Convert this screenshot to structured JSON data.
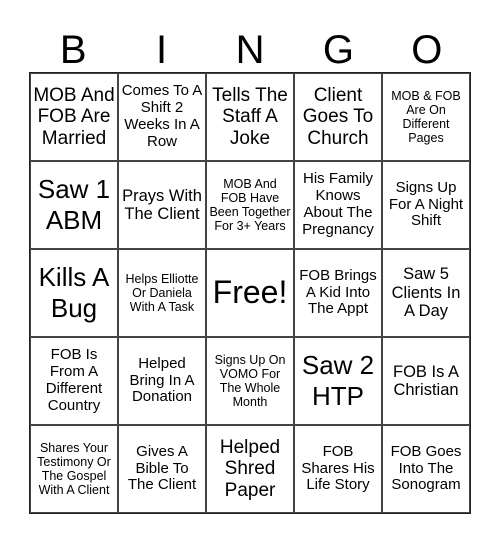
{
  "header": [
    "B",
    "I",
    "N",
    "G",
    "O"
  ],
  "cells": [
    "MOB And FOB Are Married",
    "Comes To A Shift 2 Weeks In A Row",
    "Tells The Staff A Joke",
    "Client Goes To Church",
    "MOB & FOB Are On Different Pages",
    "Saw 1 ABM",
    "Prays With The Client",
    "MOB And FOB Have Been Together For 3+ Years",
    "His Family Knows About The Pregnancy",
    "Signs Up For A Night Shift",
    "Kills A Bug",
    "Helps Elliotte Or Daniela With A Task",
    "Free!",
    "FOB Brings A Kid Into The Appt",
    "Saw 5 Clients In A Day",
    "FOB Is From A Different Country",
    "Helped Bring In A Donation",
    "Signs Up On VOMO For The Whole Month",
    "Saw 2 HTP",
    "FOB Is A Christian",
    "Shares Your Testimony Or The Gospel With A Client",
    "Gives A Bible To The Client",
    "Helped Shred Paper",
    "FOB Shares His Life Story",
    "FOB Goes Into The Sonogram"
  ]
}
